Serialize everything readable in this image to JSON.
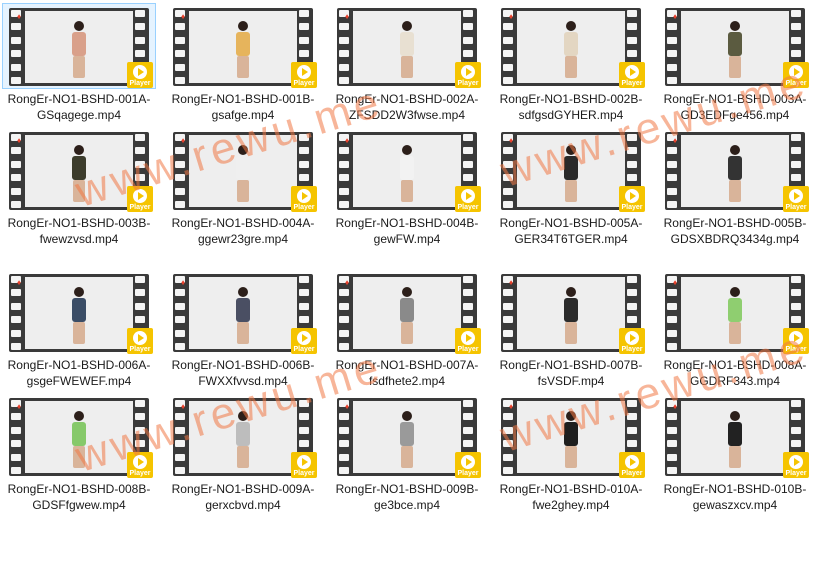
{
  "files": [
    {
      "name": "RongEr-NO1-BSHD-001A-GSqagege.mp4",
      "selected": true,
      "color": "#d9a08a"
    },
    {
      "name": "RongEr-NO1-BSHD-001B-gsafge.mp4",
      "color": "#e6b45c"
    },
    {
      "name": "RongEr-NO1-BSHD-002A-ZFSDD2W3fwse.mp4",
      "color": "#e8e0d2"
    },
    {
      "name": "RongEr-NO1-BSHD-002B-sdfgsdGYHER.mp4",
      "color": "#e3d6c2"
    },
    {
      "name": "RongEr-NO1-BSHD-003A-GD3EDFge456.mp4",
      "color": "#5b5b40"
    },
    {
      "name": "RongEr-NO1-BSHD-003B-fwewzvsd.mp4",
      "color": "#3c3c2c"
    },
    {
      "name": "RongEr-NO1-BSHD-004A-ggewr23gre.mp4",
      "color": "#efefef"
    },
    {
      "name": "RongEr-NO1-BSHD-004B-gewFW.mp4",
      "color": "#f2f2f2"
    },
    {
      "name": "RongEr-NO1-BSHD-005A-GER34T6TGER.mp4",
      "color": "#2a2a2a"
    },
    {
      "name": "RongEr-NO1-BSHD-005B-GDSXBDRQ3434g.mp4",
      "color": "#333333"
    },
    {
      "name": "RongEr-NO1-BSHD-006A-gsgeFWEWEF.mp4",
      "color": "#3b4d66"
    },
    {
      "name": "RongEr-NO1-BSHD-006B-FWXXfvvsd.mp4",
      "color": "#4a4f63"
    },
    {
      "name": "RongEr-NO1-BSHD-007A-fsdfhete2.mp4",
      "color": "#8a8a8a"
    },
    {
      "name": "RongEr-NO1-BSHD-007B-fsVSDF.mp4",
      "color": "#2b2b2b"
    },
    {
      "name": "RongEr-NO1-BSHD-008A-GGDRF343.mp4",
      "color": "#8fce70"
    },
    {
      "name": "RongEr-NO1-BSHD-008B-GDSFfgwew.mp4",
      "color": "#86c96a"
    },
    {
      "name": "RongEr-NO1-BSHD-009A-gerxcbvd.mp4",
      "color": "#bdbdbd"
    },
    {
      "name": "RongEr-NO1-BSHD-009B-ge3bce.mp4",
      "color": "#9a9a9a"
    },
    {
      "name": "RongEr-NO1-BSHD-010A-fwe2ghey.mp4",
      "color": "#1e1e1e"
    },
    {
      "name": "RongEr-NO1-BSHD-010B-gewaszxcv.mp4",
      "color": "#222222"
    }
  ],
  "badge_text": "Player",
  "watermark": "www.rewu.me"
}
